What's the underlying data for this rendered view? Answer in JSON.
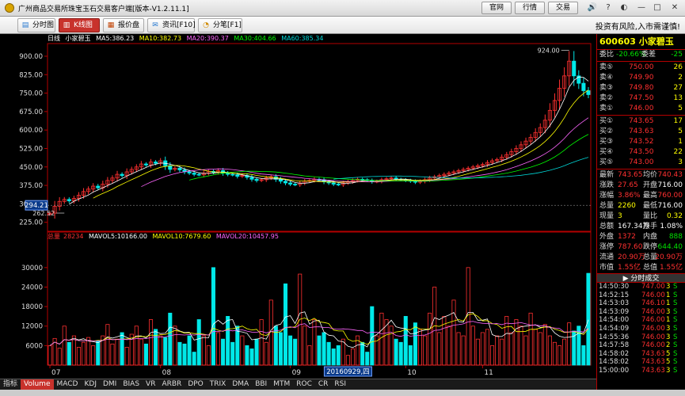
{
  "app": {
    "title": "广州商品交易所珠宝玉石交易客户端[版本-V1.2.11.1]",
    "buttons": [
      "官网",
      "行情",
      "交易"
    ]
  },
  "toolbar": {
    "items": [
      {
        "label": "分时图",
        "icon": "timeshare-icon"
      },
      {
        "label": "K线图",
        "icon": "kline-icon"
      },
      {
        "label": "报价盘",
        "icon": "quote-board-icon"
      },
      {
        "label": "资讯[F10]",
        "icon": "news-icon"
      },
      {
        "label": "分笔[F1]",
        "icon": "ticks-icon"
      }
    ],
    "warning": "投资有风险,入市需谨慎!"
  },
  "chart_head": {
    "period": "日线",
    "name": "小家碧玉",
    "ma5": "MA5:386.23",
    "ma10": "MA10:382.73",
    "ma20": "MA20:390.37",
    "ma30": "MA30:404.66",
    "ma60": "MA60:385.34",
    "colors": {
      "ma5": "#ffffff",
      "ma10": "#ffff00",
      "ma20": "#ff66ff",
      "ma30": "#00ff00",
      "ma60": "#00d8d8"
    }
  },
  "vol_head": {
    "label": "总量",
    "total": "28234",
    "mavol5": "MAVOL5:10166.00",
    "mavol10": "MAVOL10:7679.60",
    "mavol20": "MAVOL20:10457.95"
  },
  "tabs": [
    "指标",
    "Volume",
    "MACD",
    "KDJ",
    "DMI",
    "BIAS",
    "VR",
    "ARBR",
    "DPO",
    "TRIX",
    "DMA",
    "BBI",
    "MTM",
    "ROC",
    "CR",
    "RSI"
  ],
  "side": {
    "code": "600603",
    "name": "小家碧玉",
    "weibi_label": "委比",
    "weibi": "-20.66%",
    "weicha_label": "委差",
    "weicha": "-25",
    "asks": [
      {
        "label": "卖⑤",
        "price": "750.00",
        "vol": "26"
      },
      {
        "label": "卖④",
        "price": "749.90",
        "vol": "2"
      },
      {
        "label": "卖③",
        "price": "749.80",
        "vol": "27"
      },
      {
        "label": "卖②",
        "price": "747.50",
        "vol": "13"
      },
      {
        "label": "卖①",
        "price": "746.00",
        "vol": "5"
      }
    ],
    "bids": [
      {
        "label": "买①",
        "price": "743.65",
        "vol": "17"
      },
      {
        "label": "买②",
        "price": "743.63",
        "vol": "5"
      },
      {
        "label": "买③",
        "price": "743.52",
        "vol": "1"
      },
      {
        "label": "买④",
        "price": "743.50",
        "vol": "22"
      },
      {
        "label": "买⑤",
        "price": "743.00",
        "vol": "3"
      }
    ],
    "stats": [
      {
        "l1": "最新",
        "v1": "743.65",
        "c1": "up",
        "l2": "均价",
        "v2": "740.43",
        "c2": "up"
      },
      {
        "l1": "涨跌",
        "v1": "27.65",
        "c1": "up",
        "l2": "开盘",
        "v2": "716.00",
        "c2": "whi"
      },
      {
        "l1": "涨幅",
        "v1": "3.86%",
        "c1": "up",
        "l2": "最高",
        "v2": "760.00",
        "c2": "up"
      },
      {
        "l1": "总量",
        "v1": "2260",
        "c1": "yel",
        "l2": "最低",
        "v2": "716.00",
        "c2": "whi"
      },
      {
        "l1": "现量",
        "v1": "3",
        "c1": "yel",
        "l2": "量比",
        "v2": "0.32",
        "c2": "yel"
      },
      {
        "l1": "总额",
        "v1": "167.34万",
        "c1": "whi",
        "l2": "换手",
        "v2": "1.08%",
        "c2": "whi"
      },
      {
        "l1": "外盘",
        "v1": "1372",
        "c1": "up",
        "l2": "内盘",
        "v2": "888",
        "c2": "down"
      },
      {
        "l1": "涨停",
        "v1": "787.60",
        "c1": "up",
        "l2": "跌停",
        "v2": "644.40",
        "c2": "down"
      },
      {
        "l1": "流通",
        "v1": "20.90万",
        "c1": "up",
        "l2": "总量",
        "v2": "20.90万",
        "c2": "up"
      },
      {
        "l1": "市值",
        "v1": "1.55亿",
        "c1": "up",
        "l2": "总值",
        "v2": "1.55亿",
        "c2": "up"
      }
    ],
    "ticks_title": "分时成交",
    "ticks": [
      {
        "time": "14:50:30",
        "price": "747.00",
        "vol": "3",
        "dir": "S"
      },
      {
        "time": "14:52:15",
        "price": "746.00",
        "vol": "1",
        "dir": "S"
      },
      {
        "time": "14:53:03",
        "price": "746.10",
        "vol": "1",
        "dir": "S"
      },
      {
        "time": "14:53:09",
        "price": "746.00",
        "vol": "3",
        "dir": "S"
      },
      {
        "time": "14:54:00",
        "price": "746.00",
        "vol": "1",
        "dir": "S"
      },
      {
        "time": "14:54:09",
        "price": "746.00",
        "vol": "3",
        "dir": "S"
      },
      {
        "time": "14:55:36",
        "price": "746.00",
        "vol": "3",
        "dir": "S"
      },
      {
        "time": "14:57:58",
        "price": "746.00",
        "vol": "2",
        "dir": "S"
      },
      {
        "time": "14:58:02",
        "price": "743.63",
        "vol": "5",
        "dir": "S"
      },
      {
        "time": "14:58:02",
        "price": "743.63",
        "vol": "5",
        "dir": "S"
      },
      {
        "time": "15:00:00",
        "price": "743.63",
        "vol": "3",
        "dir": "S"
      }
    ]
  },
  "chart_data": {
    "type": "candlestick",
    "price_axis": {
      "ticks": [
        225,
        300,
        375,
        450,
        525,
        600,
        675,
        750,
        825,
        900
      ],
      "ylim": [
        195,
        945
      ]
    },
    "volume_axis": {
      "ticks": [
        6000,
        12000,
        18000,
        24000,
        30000
      ],
      "ylim": [
        0,
        38000
      ]
    },
    "x_labels": [
      {
        "label": "07",
        "index": 0
      },
      {
        "label": "08",
        "index": 23
      },
      {
        "label": "09",
        "index": 50
      },
      {
        "label": "10",
        "index": 74
      },
      {
        "label": "11",
        "index": 90
      }
    ],
    "cursor_price": "294.21",
    "cursor_date": "20160929,四",
    "cursor_index": 62,
    "annotations": [
      {
        "text": "924.00",
        "index": 108
      },
      {
        "text": "262.52",
        "index": 3
      }
    ],
    "close": [
      262,
      290,
      310,
      318,
      312,
      322,
      335,
      350,
      360,
      372,
      365,
      380,
      395,
      405,
      420,
      415,
      430,
      440,
      450,
      462,
      458,
      470,
      465,
      475,
      455,
      440,
      445,
      438,
      430,
      425,
      420,
      418,
      425,
      432,
      428,
      435,
      425,
      420,
      418,
      412,
      415,
      408,
      400,
      395,
      398,
      405,
      410,
      400,
      392,
      385,
      380,
      378,
      385,
      392,
      395,
      400,
      398,
      390,
      385,
      380,
      378,
      385,
      390,
      395,
      400,
      398,
      395,
      390,
      392,
      398,
      402,
      405,
      400,
      398,
      395,
      392,
      388,
      392,
      398,
      405,
      410,
      415,
      420,
      425,
      430,
      435,
      440,
      445,
      450,
      455,
      460,
      468,
      475,
      480,
      490,
      500,
      512,
      525,
      540,
      555,
      570,
      590,
      610,
      640,
      680,
      720,
      770,
      820,
      880,
      820,
      790,
      760,
      744
    ],
    "volume": [
      6000,
      8200,
      5200,
      12000,
      7000,
      9000,
      5500,
      7000,
      8500,
      6000,
      7500,
      9000,
      12500,
      6500,
      8000,
      10000,
      5500,
      9500,
      12000,
      8000,
      6500,
      14000,
      11000,
      9000,
      8500,
      16000,
      12000,
      7000,
      6500,
      9000,
      4000,
      14000,
      9000,
      6000,
      30000,
      10000,
      8000,
      15000,
      7000,
      12000,
      9000,
      6000,
      5000,
      8000,
      14000,
      7000,
      20000,
      12000,
      10000,
      25000,
      9000,
      8000,
      28000,
      12000,
      6000,
      14000,
      9000,
      10000,
      7000,
      5000,
      6000,
      8000,
      3000,
      5000,
      9000,
      7000,
      4000,
      18000,
      9000,
      16000,
      14000,
      12000,
      8000,
      7000,
      15000,
      6000,
      13000,
      11000,
      9000,
      16000,
      24000,
      10000,
      15000,
      12000,
      20000,
      10000,
      9000,
      30000,
      12000,
      8000,
      10000,
      11000,
      6000,
      9000,
      8000,
      15000,
      10000,
      14000,
      12000,
      9000,
      16000,
      11000,
      10000,
      12500,
      9000,
      7000,
      6000,
      8000,
      13000,
      10500,
      12000,
      6000,
      28234
    ],
    "ma_colors": {
      "ma5": "#ffffff",
      "ma10": "#ffff00",
      "ma20": "#ff66ff",
      "ma30": "#00ff00",
      "ma60": "#00d8d8"
    },
    "up_color": "#ff3030",
    "down_color": "#00e8e8",
    "axis_color": "#b40000"
  }
}
